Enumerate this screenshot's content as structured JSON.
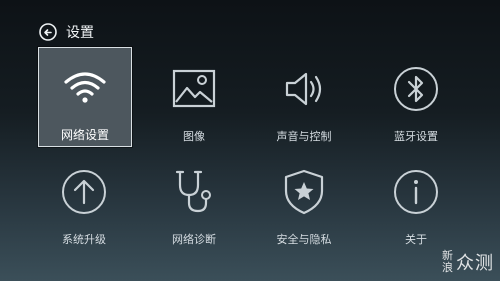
{
  "header": {
    "back_icon": "back-circle-arrow-icon",
    "title": "设置"
  },
  "tiles": [
    {
      "label": "网络设置",
      "icon": "wifi-icon",
      "selected": true
    },
    {
      "label": "图像",
      "icon": "image-icon",
      "selected": false
    },
    {
      "label": "声音与控制",
      "icon": "speaker-icon",
      "selected": false
    },
    {
      "label": "蓝牙设置",
      "icon": "bluetooth-icon",
      "selected": false
    },
    {
      "label": "系统升级",
      "icon": "upgrade-arrow-icon",
      "selected": false
    },
    {
      "label": "网络诊断",
      "icon": "stethoscope-icon",
      "selected": false
    },
    {
      "label": "安全与隐私",
      "icon": "shield-star-icon",
      "selected": false
    },
    {
      "label": "关于",
      "icon": "info-icon",
      "selected": false
    }
  ],
  "watermark": {
    "line1": "新",
    "line2": "浪",
    "brand": "众测"
  },
  "colors": {
    "icon_stroke": "#c9d1d6",
    "selected_bg": "#4d575e",
    "selected_border": "#d9e0e4"
  }
}
